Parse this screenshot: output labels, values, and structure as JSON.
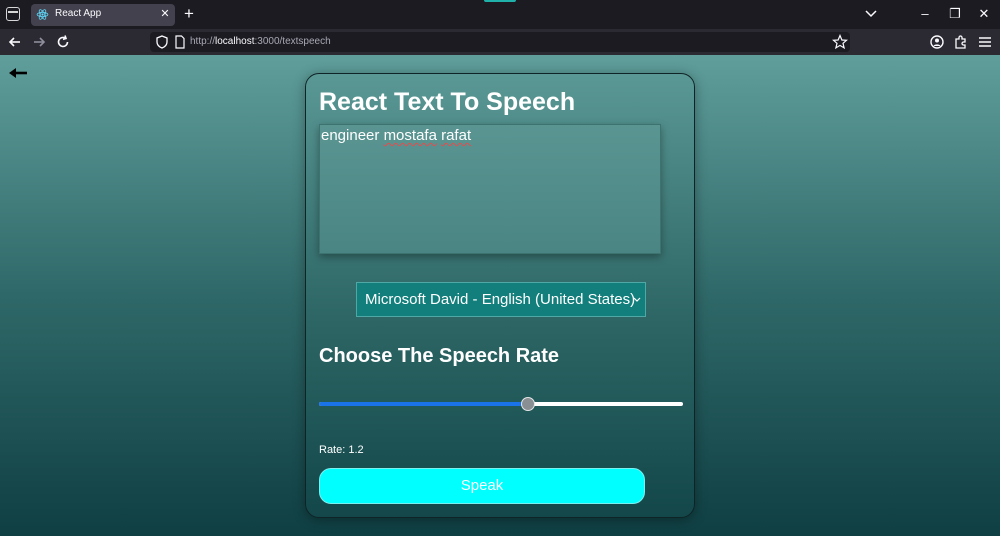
{
  "browser": {
    "tab": {
      "title": "React App",
      "favicon": "react-logo-icon",
      "close_glyph": "✕"
    },
    "new_tab_glyph": "+",
    "url": {
      "prefix": "http://",
      "host": "localhost",
      "suffix": ":3000/textspeech"
    },
    "window_controls": {
      "minimize": "–",
      "restore": "❐",
      "close": "✕"
    },
    "icons": [
      "tab-list-icon",
      "back-icon",
      "forward-icon",
      "reload-icon",
      "shield-icon",
      "page-icon",
      "star-icon",
      "account-icon",
      "extensions-icon",
      "menu-icon"
    ]
  },
  "page": {
    "back_icon": "left-arrow-icon",
    "title": "React Text To Speech",
    "textarea": {
      "words": [
        {
          "text": "engineer ",
          "misspelled": false
        },
        {
          "text": "mostafa",
          "misspelled": true
        },
        {
          "text": " ",
          "misspelled": false
        },
        {
          "text": "rafat",
          "misspelled": true
        }
      ]
    },
    "voice_select": {
      "selected": "Microsoft David - English (United States) (en-US)"
    },
    "rate_heading": "Choose The Speech Rate",
    "rate": {
      "prefix": "Rate: ",
      "value": "1.2",
      "fraction": 0.575
    },
    "speak_label": "Speak"
  },
  "colors": {
    "accent": "#00ffff",
    "select_bg": "#137f7c",
    "slider_fill": "#1a73e8",
    "page_top": "#5f9e9b",
    "page_bottom": "#0f3f43"
  }
}
